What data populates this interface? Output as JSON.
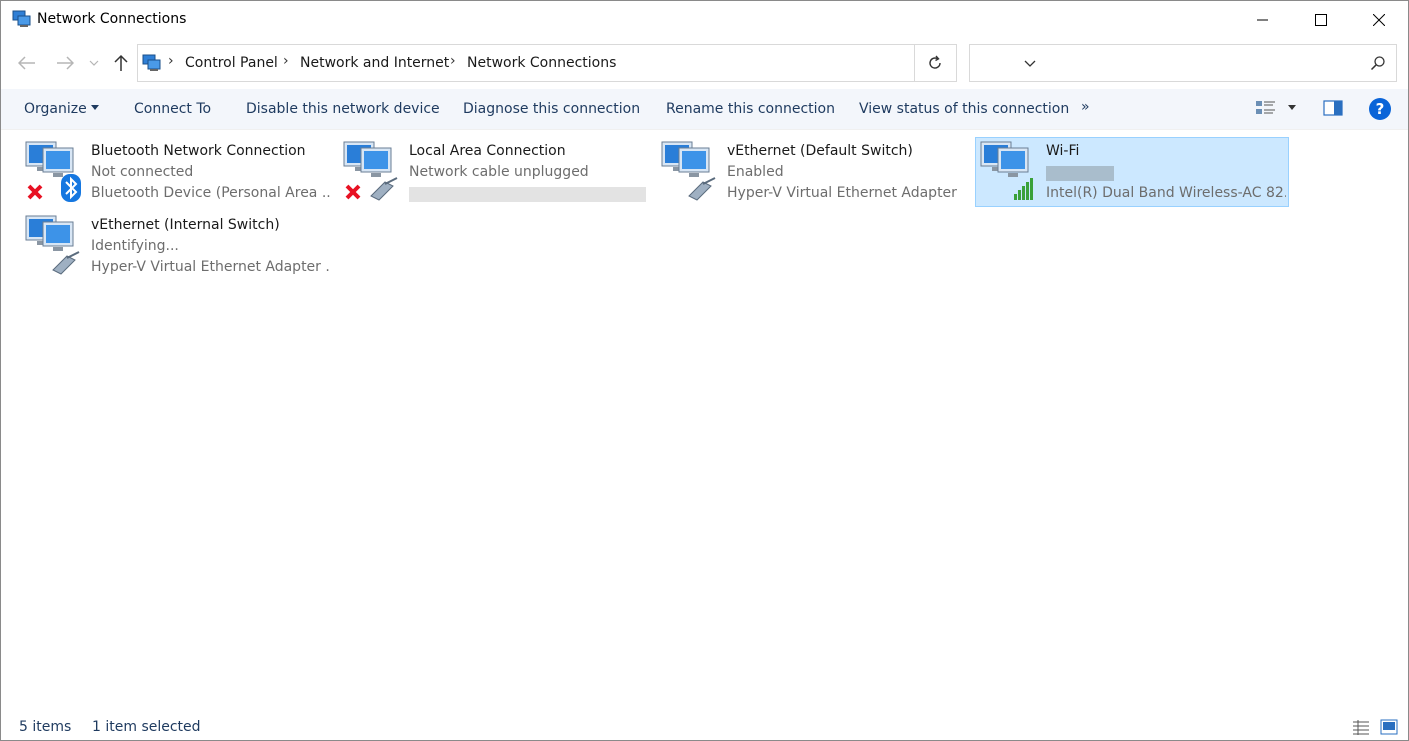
{
  "window": {
    "title": "Network Connections"
  },
  "address": {
    "breadcrumbs": [
      "Control Panel",
      "Network and Internet",
      "Network Connections"
    ],
    "search_placeholder": ""
  },
  "commands": {
    "organize": "Organize",
    "connect_to": "Connect To",
    "disable": "Disable this network device",
    "diagnose": "Diagnose this connection",
    "rename": "Rename this connection",
    "view_status": "View status of this connection",
    "more": "»"
  },
  "connections": [
    {
      "name": "Bluetooth Network Connection",
      "status": "Not connected",
      "device": "Bluetooth Device (Personal Area ...",
      "icon": "bluetooth-network-icon",
      "state": "disconnected"
    },
    {
      "name": "Local Area Connection",
      "status": "Network cable unplugged",
      "device": "",
      "icon": "ethernet-network-icon",
      "state": "disconnected"
    },
    {
      "name": "vEthernet (Default Switch)",
      "status": "Enabled",
      "device": "Hyper-V Virtual Ethernet Adapter",
      "icon": "ethernet-network-icon",
      "state": "connected"
    },
    {
      "name": "Wi-Fi",
      "status": "",
      "device": "Intel(R) Dual Band Wireless-AC 82...",
      "icon": "wifi-network-icon",
      "state": "connected",
      "selected": true
    },
    {
      "name": "vEthernet (Internal Switch)",
      "status": "Identifying...",
      "device": "Hyper-V Virtual Ethernet Adapter ...",
      "icon": "ethernet-network-icon",
      "state": "connected"
    }
  ],
  "statusbar": {
    "count": "5 items",
    "selection": "1 item selected"
  },
  "colors": {
    "accent": "#0a64d8",
    "selection_bg": "#cce8ff",
    "selection_border": "#99d1ff",
    "command_text": "#1e3a5f",
    "disconnected": "#e81123"
  }
}
